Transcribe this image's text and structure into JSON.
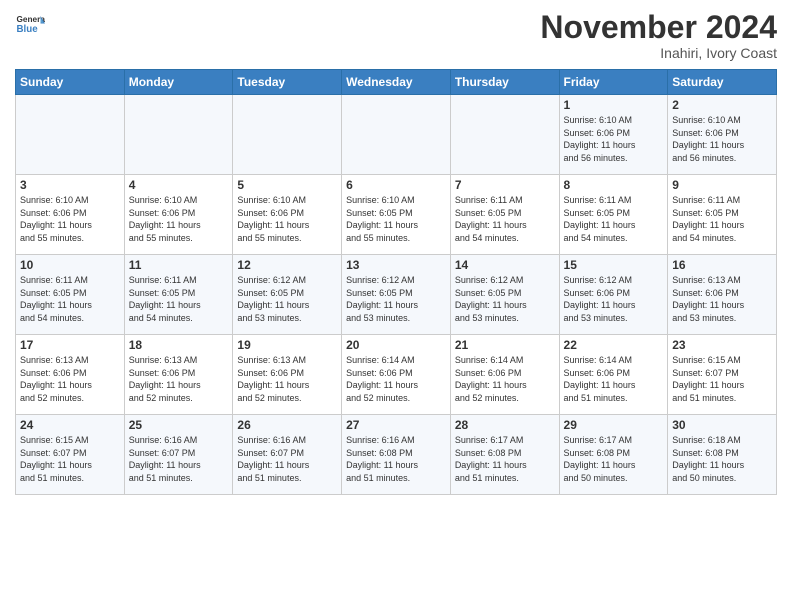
{
  "header": {
    "logo": {
      "general": "General",
      "blue": "Blue"
    },
    "title": "November 2024",
    "location": "Inahiri, Ivory Coast"
  },
  "weekdays": [
    "Sunday",
    "Monday",
    "Tuesday",
    "Wednesday",
    "Thursday",
    "Friday",
    "Saturday"
  ],
  "weeks": [
    [
      {
        "day": "",
        "info": ""
      },
      {
        "day": "",
        "info": ""
      },
      {
        "day": "",
        "info": ""
      },
      {
        "day": "",
        "info": ""
      },
      {
        "day": "",
        "info": ""
      },
      {
        "day": "1",
        "info": "Sunrise: 6:10 AM\nSunset: 6:06 PM\nDaylight: 11 hours\nand 56 minutes."
      },
      {
        "day": "2",
        "info": "Sunrise: 6:10 AM\nSunset: 6:06 PM\nDaylight: 11 hours\nand 56 minutes."
      }
    ],
    [
      {
        "day": "3",
        "info": "Sunrise: 6:10 AM\nSunset: 6:06 PM\nDaylight: 11 hours\nand 55 minutes."
      },
      {
        "day": "4",
        "info": "Sunrise: 6:10 AM\nSunset: 6:06 PM\nDaylight: 11 hours\nand 55 minutes."
      },
      {
        "day": "5",
        "info": "Sunrise: 6:10 AM\nSunset: 6:06 PM\nDaylight: 11 hours\nand 55 minutes."
      },
      {
        "day": "6",
        "info": "Sunrise: 6:10 AM\nSunset: 6:05 PM\nDaylight: 11 hours\nand 55 minutes."
      },
      {
        "day": "7",
        "info": "Sunrise: 6:11 AM\nSunset: 6:05 PM\nDaylight: 11 hours\nand 54 minutes."
      },
      {
        "day": "8",
        "info": "Sunrise: 6:11 AM\nSunset: 6:05 PM\nDaylight: 11 hours\nand 54 minutes."
      },
      {
        "day": "9",
        "info": "Sunrise: 6:11 AM\nSunset: 6:05 PM\nDaylight: 11 hours\nand 54 minutes."
      }
    ],
    [
      {
        "day": "10",
        "info": "Sunrise: 6:11 AM\nSunset: 6:05 PM\nDaylight: 11 hours\nand 54 minutes."
      },
      {
        "day": "11",
        "info": "Sunrise: 6:11 AM\nSunset: 6:05 PM\nDaylight: 11 hours\nand 54 minutes."
      },
      {
        "day": "12",
        "info": "Sunrise: 6:12 AM\nSunset: 6:05 PM\nDaylight: 11 hours\nand 53 minutes."
      },
      {
        "day": "13",
        "info": "Sunrise: 6:12 AM\nSunset: 6:05 PM\nDaylight: 11 hours\nand 53 minutes."
      },
      {
        "day": "14",
        "info": "Sunrise: 6:12 AM\nSunset: 6:05 PM\nDaylight: 11 hours\nand 53 minutes."
      },
      {
        "day": "15",
        "info": "Sunrise: 6:12 AM\nSunset: 6:06 PM\nDaylight: 11 hours\nand 53 minutes."
      },
      {
        "day": "16",
        "info": "Sunrise: 6:13 AM\nSunset: 6:06 PM\nDaylight: 11 hours\nand 53 minutes."
      }
    ],
    [
      {
        "day": "17",
        "info": "Sunrise: 6:13 AM\nSunset: 6:06 PM\nDaylight: 11 hours\nand 52 minutes."
      },
      {
        "day": "18",
        "info": "Sunrise: 6:13 AM\nSunset: 6:06 PM\nDaylight: 11 hours\nand 52 minutes."
      },
      {
        "day": "19",
        "info": "Sunrise: 6:13 AM\nSunset: 6:06 PM\nDaylight: 11 hours\nand 52 minutes."
      },
      {
        "day": "20",
        "info": "Sunrise: 6:14 AM\nSunset: 6:06 PM\nDaylight: 11 hours\nand 52 minutes."
      },
      {
        "day": "21",
        "info": "Sunrise: 6:14 AM\nSunset: 6:06 PM\nDaylight: 11 hours\nand 52 minutes."
      },
      {
        "day": "22",
        "info": "Sunrise: 6:14 AM\nSunset: 6:06 PM\nDaylight: 11 hours\nand 51 minutes."
      },
      {
        "day": "23",
        "info": "Sunrise: 6:15 AM\nSunset: 6:07 PM\nDaylight: 11 hours\nand 51 minutes."
      }
    ],
    [
      {
        "day": "24",
        "info": "Sunrise: 6:15 AM\nSunset: 6:07 PM\nDaylight: 11 hours\nand 51 minutes."
      },
      {
        "day": "25",
        "info": "Sunrise: 6:16 AM\nSunset: 6:07 PM\nDaylight: 11 hours\nand 51 minutes."
      },
      {
        "day": "26",
        "info": "Sunrise: 6:16 AM\nSunset: 6:07 PM\nDaylight: 11 hours\nand 51 minutes."
      },
      {
        "day": "27",
        "info": "Sunrise: 6:16 AM\nSunset: 6:08 PM\nDaylight: 11 hours\nand 51 minutes."
      },
      {
        "day": "28",
        "info": "Sunrise: 6:17 AM\nSunset: 6:08 PM\nDaylight: 11 hours\nand 51 minutes."
      },
      {
        "day": "29",
        "info": "Sunrise: 6:17 AM\nSunset: 6:08 PM\nDaylight: 11 hours\nand 50 minutes."
      },
      {
        "day": "30",
        "info": "Sunrise: 6:18 AM\nSunset: 6:08 PM\nDaylight: 11 hours\nand 50 minutes."
      }
    ]
  ]
}
